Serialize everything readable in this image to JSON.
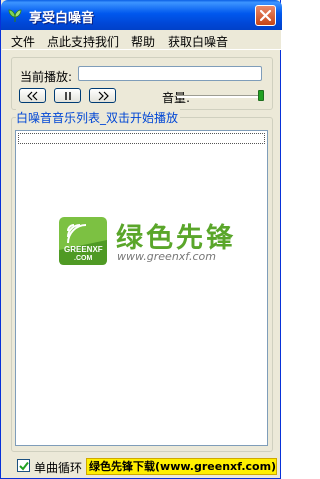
{
  "window": {
    "title": "享受白噪音",
    "title_color": "#0058ee",
    "app_icon": "green-leaf-icon",
    "close_icon": "close-icon"
  },
  "menu": {
    "items": [
      {
        "label": "文件"
      },
      {
        "label": "点此支持我们"
      },
      {
        "label": "帮助"
      },
      {
        "label": "获取白噪音"
      }
    ]
  },
  "player": {
    "now_playing_label": "当前播放:",
    "now_playing_value": "",
    "buttons": [
      {
        "name": "previous",
        "icon": "rewind-icon"
      },
      {
        "name": "pause",
        "icon": "pause-icon"
      },
      {
        "name": "next",
        "icon": "fast-forward-icon"
      }
    ],
    "volume_label": "音量:",
    "volume_level": 1.0
  },
  "playlist": {
    "caption": "白噪音音乐列表_双击开始播放",
    "items": []
  },
  "watermark": {
    "logo_text_top": "GREENXF",
    "logo_text_bottom": ".COM",
    "title": "绿色先锋",
    "url": "www.greenxf.com",
    "brand_color": "#5aa62a"
  },
  "footer": {
    "loop_label": "单曲循环",
    "loop_checked": true,
    "banner": "绿色先锋下载(www.greenxf.com)",
    "banner_color": "#ffef00"
  }
}
